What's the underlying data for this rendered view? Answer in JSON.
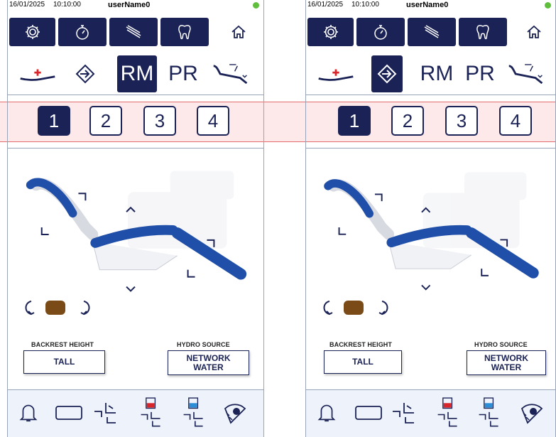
{
  "status": {
    "date": "16/01/2025",
    "time": "10:10:00",
    "user": "userName0",
    "led_color": "#5fbf3c"
  },
  "toolbar_icons": [
    "settings-gear-icon",
    "stopwatch-icon",
    "instruments-icon",
    "tooth-icon",
    "home-icon"
  ],
  "modes": [
    "RM",
    "PR"
  ],
  "memory_positions": [
    "1",
    "2",
    "3",
    "4"
  ],
  "backrest": {
    "label": "BACKREST HEIGHT",
    "value": "TALL"
  },
  "hydro": {
    "label": "HYDRO SOURCE",
    "value_line1": "NETWORK",
    "value_line2": "WATER"
  },
  "bottom_icons": [
    "bell-icon",
    "tray-icon",
    "cup-filler-icon",
    "cup-filler-red-icon",
    "cup-filler-blue-icon",
    "light-icon"
  ],
  "colors": {
    "navy": "#1b2356",
    "accent_blue": "#1f4fa8",
    "highlight_red": "#e36b6b"
  }
}
